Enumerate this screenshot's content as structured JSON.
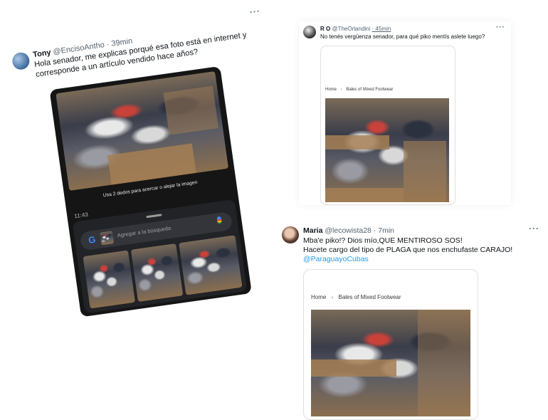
{
  "tweet1": {
    "name": "Tony",
    "handle": "@EncisoAntho",
    "time": "· 39min",
    "more": "···",
    "text": "Hola senador, me explicas porqué esa foto está en internet y corresponde a un artículo vendido hace años?",
    "screenshot": {
      "hint": "Usa 2 dedos para acercar o alejar la imagen",
      "time": "11:43",
      "search_placeholder": "Agregar a la búsqueda",
      "google_glyph": "G"
    }
  },
  "tweet2": {
    "name": "R O",
    "handle": "@TheOrlandini",
    "time": "· 45min",
    "more": "···",
    "text": "No tenés vergüenza senador, para qué piko mentís aslete luego?",
    "card": {
      "breadcrumb_home": "Home",
      "breadcrumb_page": "Bales of Mixed Footwear"
    }
  },
  "tweet3": {
    "name": "Maria",
    "handle": "@lecowista28",
    "time": "· 7min",
    "more": "···",
    "line1": "Mba'e piko!? Dios mío,QUE MENTIROSO SOS!",
    "line2": "Hacete cargo del tipo de PLAGA que nos enchufaste CARAJO!",
    "mention": "@ParaguayoCubas",
    "card": {
      "breadcrumb_home": "Home",
      "breadcrumb_page": "Bales of Mixed Footwear"
    }
  },
  "colors": {
    "link": "#1d9bf0",
    "muted": "#536471",
    "sheet": "#222326"
  }
}
